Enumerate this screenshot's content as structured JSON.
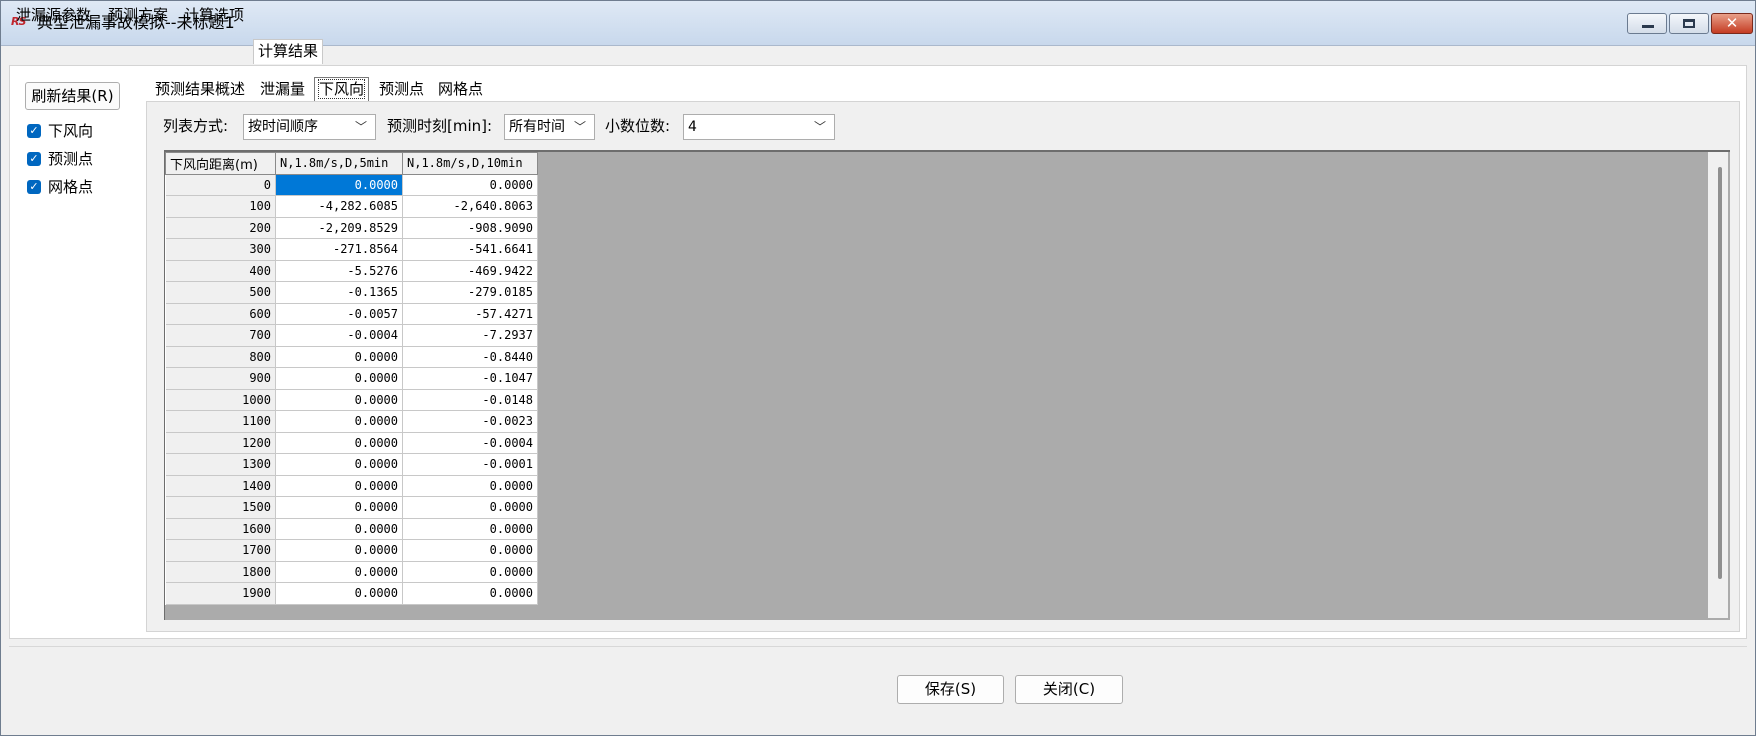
{
  "window": {
    "title": "典型泄漏事故模拟--未标题1",
    "app_icon_text": "RS",
    "minimize_glyph": "minimize-icon",
    "maximize_glyph": "maximize-icon",
    "close_glyph": "✕"
  },
  "main_tabs": [
    "泄漏源参数",
    "预测方案",
    "计算选项",
    "计算结果"
  ],
  "main_tab_active": "计算结果",
  "left": {
    "refresh_label": "刷新结果(R)",
    "checks": [
      {
        "label": "下风向",
        "checked": true
      },
      {
        "label": "预测点",
        "checked": true
      },
      {
        "label": "网格点",
        "checked": true
      }
    ]
  },
  "sub_tabs": [
    "预测结果概述",
    "泄漏量",
    "下风向",
    "预测点",
    "网格点"
  ],
  "sub_tab_active": "下风向",
  "controls": {
    "list_mode_label": "列表方式:",
    "list_mode_value": "按时间顺序",
    "time_label": "预测时刻[min]:",
    "time_value": "所有时间",
    "decimals_label": "小数位数:",
    "decimals_value": "4"
  },
  "grid": {
    "headers": [
      "下风向距离(m)",
      "N,1.8m/s,D,5min",
      "N,1.8m/s,D,10min"
    ],
    "rows": [
      [
        "0",
        "0.0000",
        "0.0000"
      ],
      [
        "100",
        "-4,282.6085",
        "-2,640.8063"
      ],
      [
        "200",
        "-2,209.8529",
        "-908.9090"
      ],
      [
        "300",
        "-271.8564",
        "-541.6641"
      ],
      [
        "400",
        "-5.5276",
        "-469.9422"
      ],
      [
        "500",
        "-0.1365",
        "-279.0185"
      ],
      [
        "600",
        "-0.0057",
        "-57.4271"
      ],
      [
        "700",
        "-0.0004",
        "-7.2937"
      ],
      [
        "800",
        "0.0000",
        "-0.8440"
      ],
      [
        "900",
        "0.0000",
        "-0.1047"
      ],
      [
        "1000",
        "0.0000",
        "-0.0148"
      ],
      [
        "1100",
        "0.0000",
        "-0.0023"
      ],
      [
        "1200",
        "0.0000",
        "-0.0004"
      ],
      [
        "1300",
        "0.0000",
        "-0.0001"
      ],
      [
        "1400",
        "0.0000",
        "0.0000"
      ],
      [
        "1500",
        "0.0000",
        "0.0000"
      ],
      [
        "1600",
        "0.0000",
        "0.0000"
      ],
      [
        "1700",
        "0.0000",
        "0.0000"
      ],
      [
        "1800",
        "0.0000",
        "0.0000"
      ],
      [
        "1900",
        "0.0000",
        "0.0000"
      ]
    ],
    "selected_cell": "0.0000"
  },
  "footer": {
    "save_label": "保存(S)",
    "close_label": "关闭(C)"
  }
}
